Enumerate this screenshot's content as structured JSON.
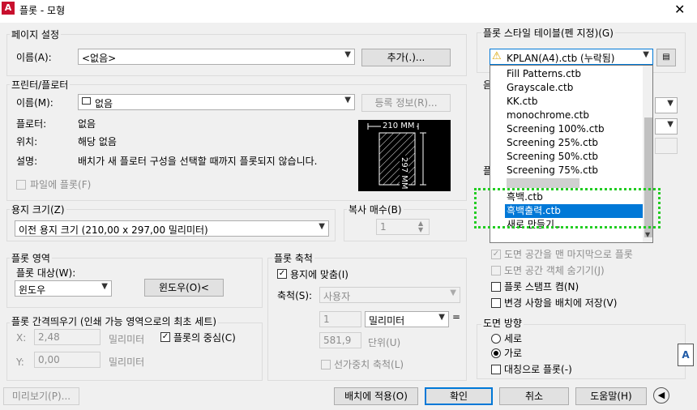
{
  "window": {
    "title": "플롯 - 모형",
    "app_icon": "A"
  },
  "page_setup": {
    "legend": "페이지 설정",
    "name_label": "이름(A):",
    "name_value": "<없음>",
    "add_button": "추가(.)..."
  },
  "printer": {
    "legend": "프린터/플로터",
    "name_label": "이름(M):",
    "name_value": "없음",
    "properties_button": "등록 정보(R)...",
    "plotter_label": "플로터:",
    "plotter_value": "없음",
    "location_label": "위치:",
    "location_value": "해당 없음",
    "description_label": "설명:",
    "description_value": "배치가 새 플로터 구성을 선택할 때까지 플롯되지 않습니다.",
    "plot_to_file": "파일에 플롯(F)",
    "preview_width": "210 MM",
    "preview_height": "297 MM"
  },
  "paper_size": {
    "legend": "용지 크기(Z)",
    "value": "이전 용지 크기 (210,00 x 297,00 밀리미터)"
  },
  "copies": {
    "legend": "복사 매수(B)",
    "value": "1"
  },
  "plot_area": {
    "legend": "플롯 영역",
    "what_label": "플롯 대상(W):",
    "what_value": "윈도우",
    "window_button": "윈도우(O)<"
  },
  "plot_offset": {
    "legend": "플롯 간격띄우기 (인쇄 가능 영역으로의 최초 세트)",
    "x_label": "X:",
    "x_value": "2,48",
    "x_unit": "밀리미터",
    "y_label": "Y:",
    "y_value": "0,00",
    "y_unit": "밀리미터",
    "center_plot": "플롯의 중심(C)"
  },
  "plot_scale": {
    "legend": "플롯 축척",
    "fit_to_paper": "용지에 맞춤(I)",
    "scale_label": "축척(S):",
    "scale_value": "사용자",
    "value1": "1",
    "unit_value": "밀리미터",
    "equals": "=",
    "value2": "581,9",
    "unit2": "단위(U)",
    "scale_lineweights": "선가중치 축척(L)"
  },
  "plot_style_table": {
    "legend": "플롯 스타일 테이블(펜 지정)(G)",
    "selected": "KPLAN(A4).ctb (누락됨)",
    "items": [
      "Fill Patterns.ctb",
      "Grayscale.ctb",
      "KK.ctb",
      "monochrome.ctb",
      "Screening 100%.ctb",
      "Screening 25%.ctb",
      "Screening 50%.ctb",
      "Screening 75%.ctb",
      "흑백.ctb",
      "흑백출력.ctb",
      "새로 만들기..."
    ],
    "highlighted_index": 9
  },
  "plot_options": {
    "paperspace_last": "도면 공간을 맨 마지막으로 플롯",
    "hide_objects": "도면 공간 객체 숨기기(J)",
    "stamp_on": "플롯 스탬프 켬(N)",
    "save_changes": "변경 사항을 배치에 저장(V)"
  },
  "orientation": {
    "legend": "도면 방향",
    "portrait": "세로",
    "landscape": "가로",
    "upside_down": "대칭으로 플롯(-)",
    "icon": "A"
  },
  "footer": {
    "preview": "미리보기(P)...",
    "apply": "배치에 적용(O)",
    "ok": "확인",
    "cancel": "취소",
    "help": "도움말(H)"
  },
  "colors": {
    "accent": "#0078d7",
    "highlight_box": "#22cc22",
    "title_icon": "#c8102e"
  }
}
